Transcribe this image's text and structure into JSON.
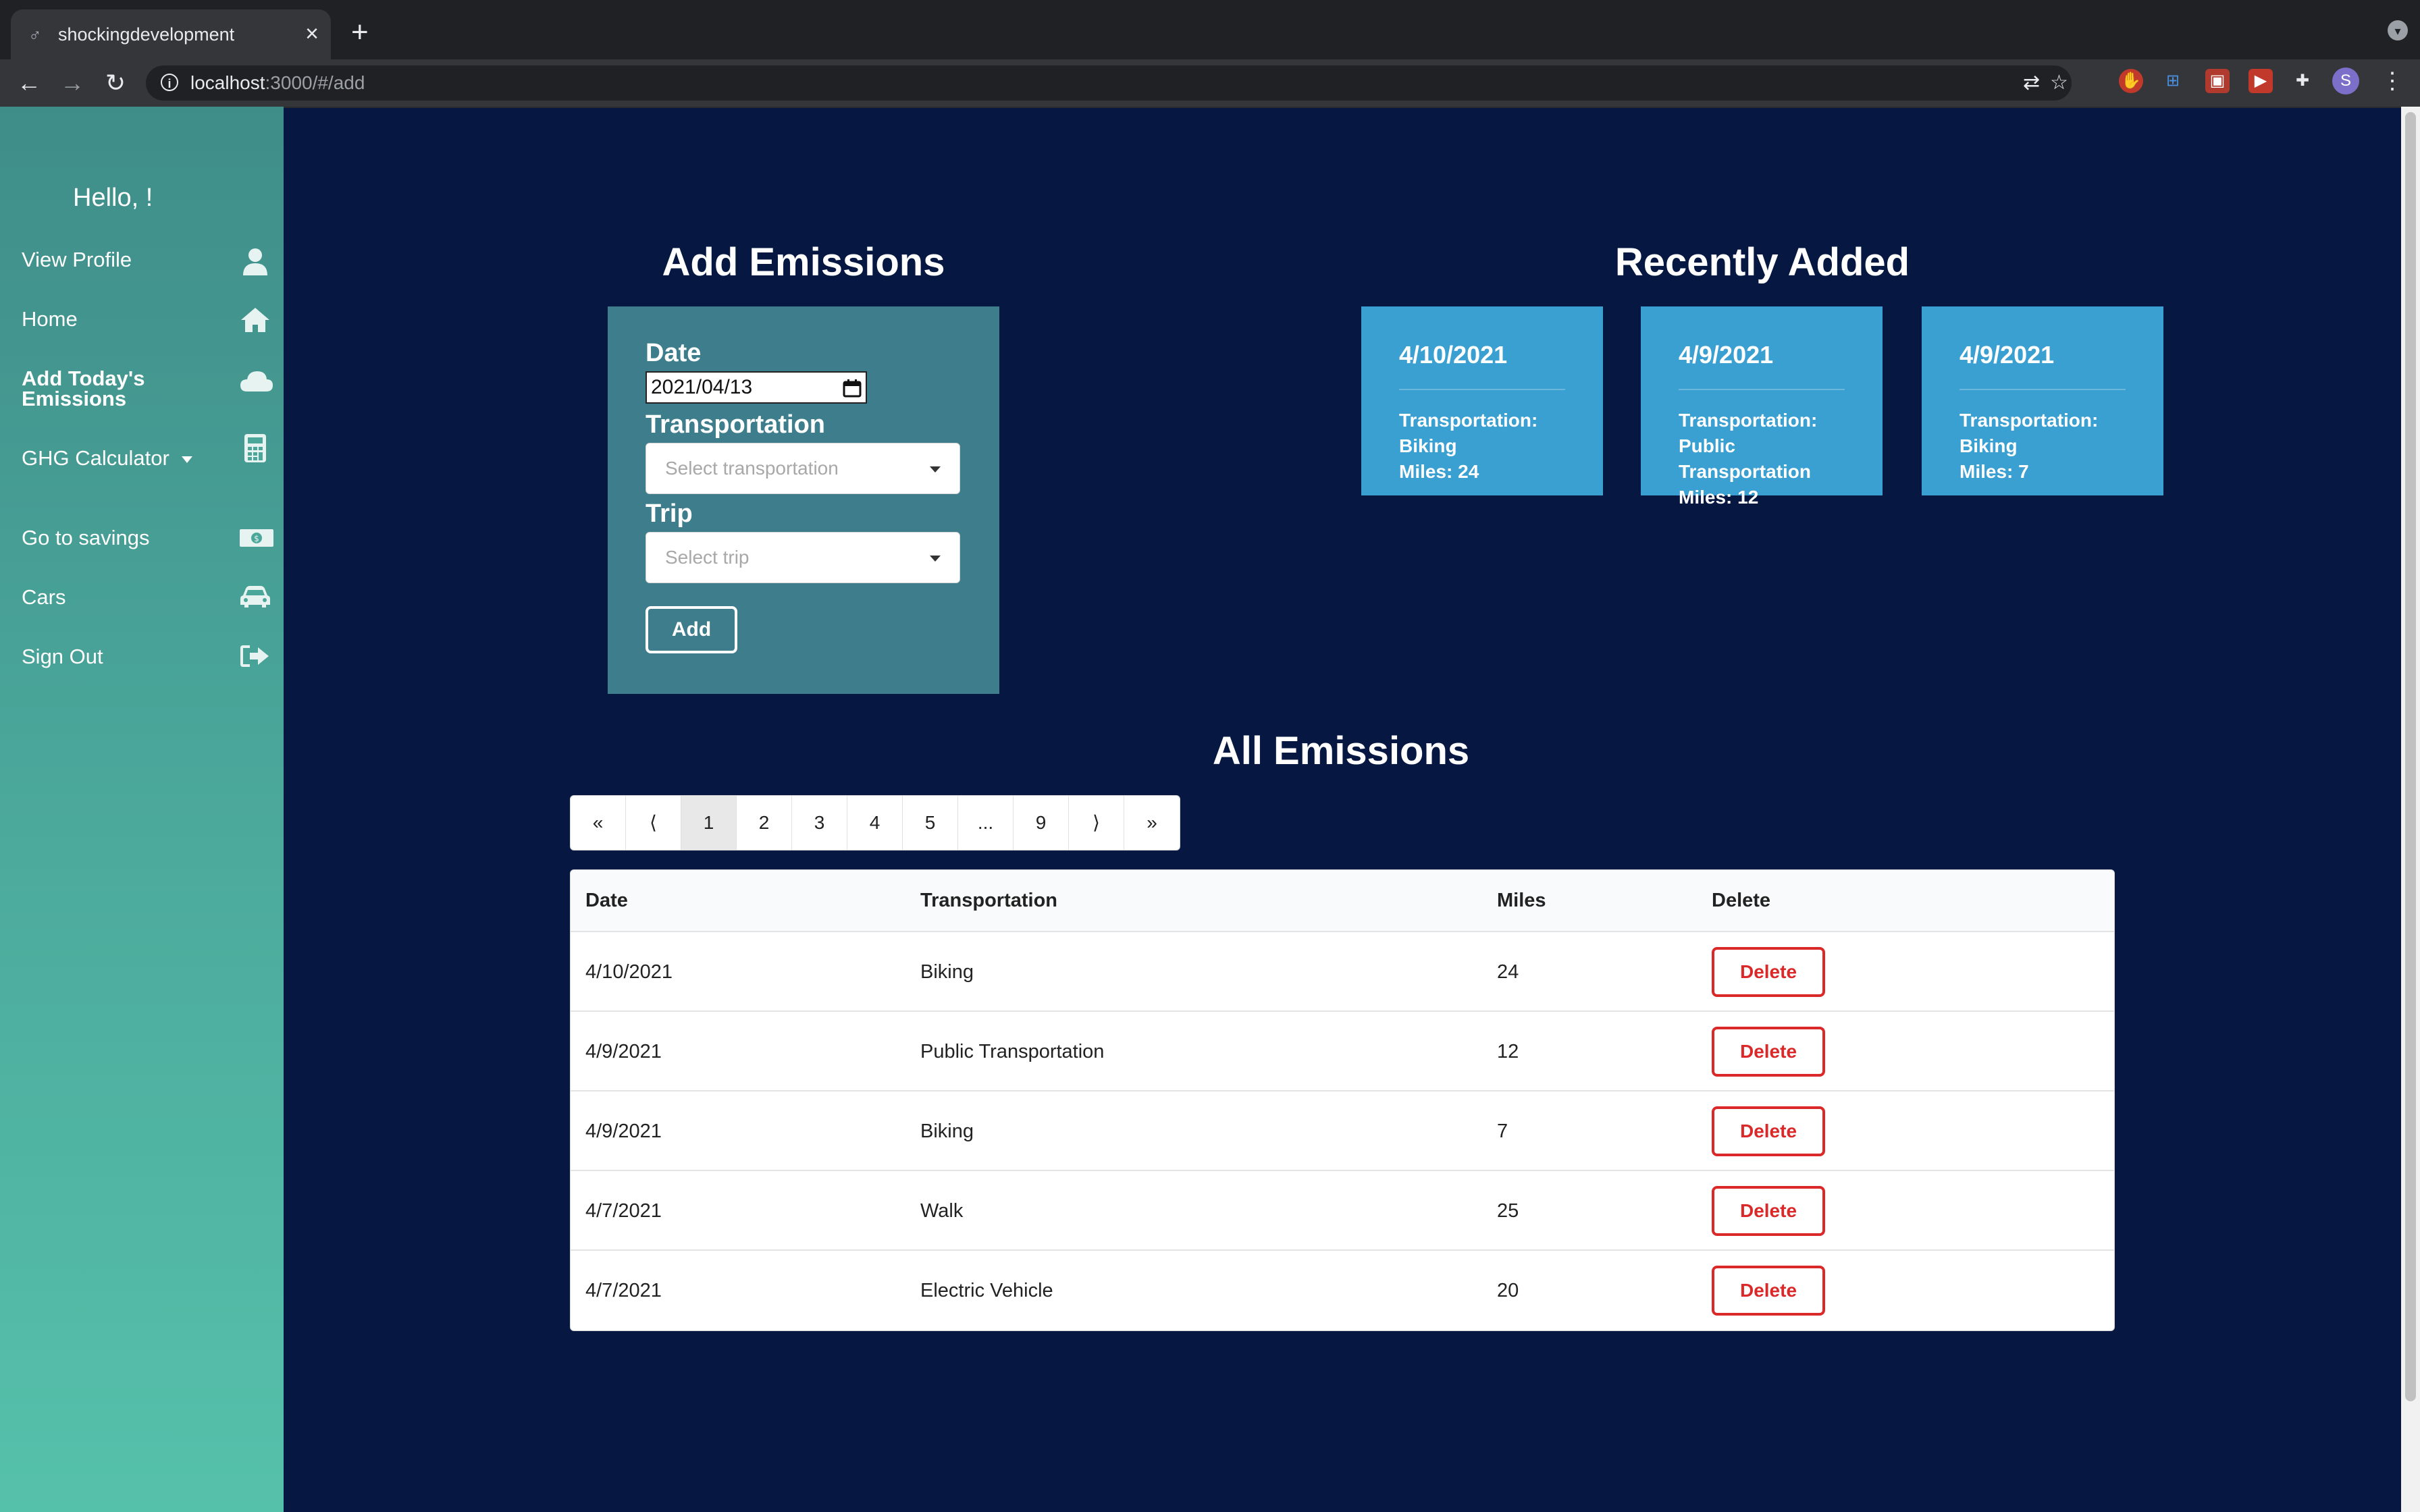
{
  "browser": {
    "tab_title": "shockingdevelopment",
    "url_host": "localhost",
    "url_rest": ":3000/#/add",
    "new_tab": "+",
    "close_tab": "×",
    "profile_initial": "S"
  },
  "sidebar": {
    "greeting": "Hello, !",
    "items": [
      {
        "label": "View Profile",
        "icon": "user-icon"
      },
      {
        "label": "Home",
        "icon": "home-icon"
      },
      {
        "label": "Add Today's Emissions",
        "icon": "cloud-icon",
        "active": true
      },
      {
        "label": "GHG Calculator",
        "icon": "calculator-icon",
        "has_dropdown": true
      },
      {
        "label": "Go to savings",
        "icon": "money-icon"
      },
      {
        "label": "Cars",
        "icon": "car-icon"
      },
      {
        "label": "Sign Out",
        "icon": "sign-out-icon"
      }
    ]
  },
  "add_form": {
    "heading": "Add Emissions",
    "date_label": "Date",
    "date_value": "2021/04/13",
    "transportation_label": "Transportation",
    "transportation_placeholder": "Select transportation",
    "trip_label": "Trip",
    "trip_placeholder": "Select trip",
    "add_button": "Add"
  },
  "recent": {
    "heading": "Recently Added",
    "cards": [
      {
        "date": "4/10/2021",
        "transportation_label": "Transportation:",
        "transportation": "Biking",
        "miles": "Miles: 24"
      },
      {
        "date": "4/9/2021",
        "transportation_label": "Transportation:",
        "transportation": "Public Transportation",
        "miles": "Miles: 12"
      },
      {
        "date": "4/9/2021",
        "transportation_label": "Transportation:",
        "transportation": "Biking",
        "miles": "Miles: 7"
      }
    ]
  },
  "all": {
    "heading": "All Emissions",
    "pagination": [
      "«",
      "⟨",
      "1",
      "2",
      "3",
      "4",
      "5",
      "...",
      "9",
      "⟩",
      "»"
    ],
    "active_page": "1",
    "columns": [
      "Date",
      "Transportation",
      "Miles",
      "Delete"
    ],
    "rows": [
      {
        "date": "4/10/2021",
        "transportation": "Biking",
        "miles": "24",
        "action": "Delete"
      },
      {
        "date": "4/9/2021",
        "transportation": "Public Transportation",
        "miles": "12",
        "action": "Delete"
      },
      {
        "date": "4/9/2021",
        "transportation": "Biking",
        "miles": "7",
        "action": "Delete"
      },
      {
        "date": "4/7/2021",
        "transportation": "Walk",
        "miles": "25",
        "action": "Delete"
      },
      {
        "date": "4/7/2021",
        "transportation": "Electric Vehicle",
        "miles": "20",
        "action": "Delete"
      }
    ]
  },
  "colors": {
    "background": "#061841",
    "sidebar_top": "#3f8d89",
    "sidebar_bottom": "#56c1ab",
    "form_card": "#3e7e8c",
    "recent_card": "#3a9fd1",
    "delete": "#db2828"
  }
}
